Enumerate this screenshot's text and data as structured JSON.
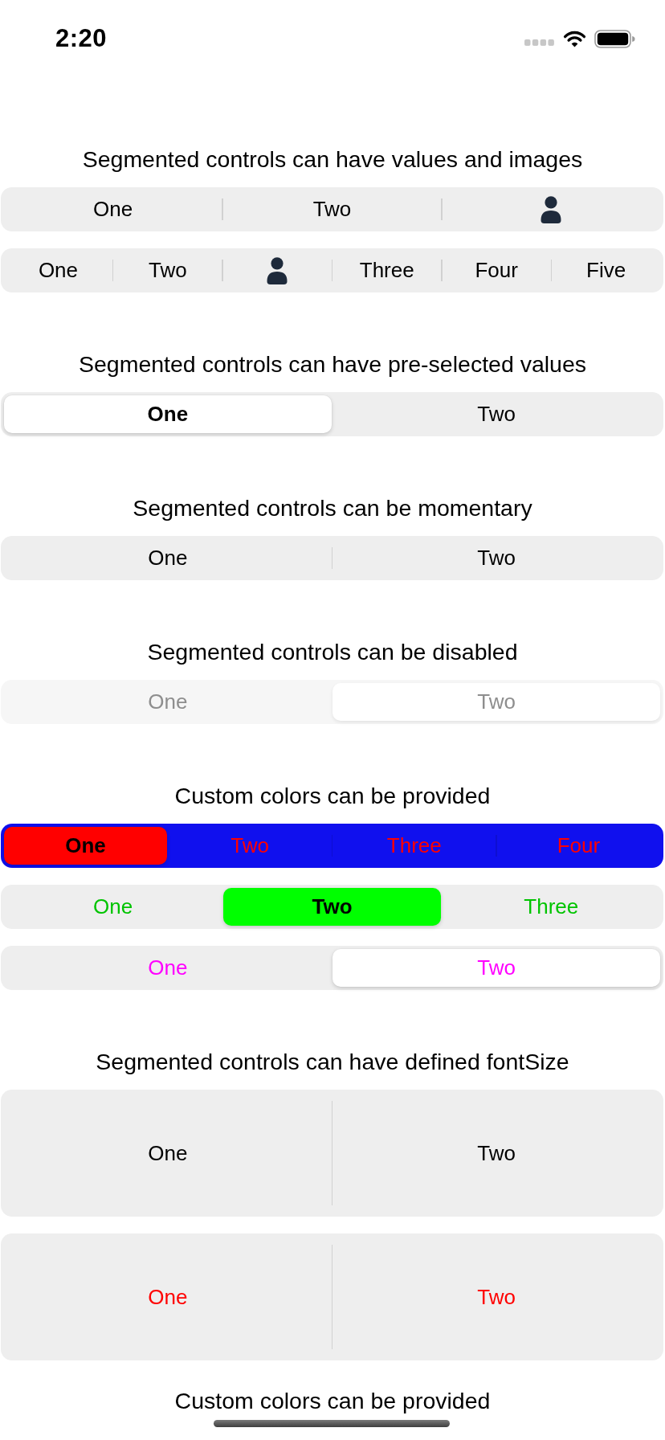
{
  "status_bar": {
    "time": "2:20"
  },
  "sections": [
    {
      "title": "Segmented controls can have values and images",
      "controls": [
        {
          "kind": "plain",
          "disabled": false,
          "segments": [
            {
              "kind": "text",
              "label": "One",
              "selected": false
            },
            {
              "kind": "text",
              "label": "Two",
              "selected": false
            },
            {
              "kind": "icon",
              "selected": false
            }
          ]
        },
        {
          "kind": "plain",
          "disabled": false,
          "segments": [
            {
              "kind": "text",
              "label": "One",
              "selected": false
            },
            {
              "kind": "text",
              "label": "Two",
              "selected": false
            },
            {
              "kind": "icon",
              "selected": false
            },
            {
              "kind": "text",
              "label": "Three",
              "selected": false
            },
            {
              "kind": "text",
              "label": "Four",
              "selected": false
            },
            {
              "kind": "text",
              "label": "Five",
              "selected": false
            }
          ]
        }
      ]
    },
    {
      "title": "Segmented controls can have pre-selected values",
      "controls": [
        {
          "kind": "plain",
          "disabled": false,
          "segments": [
            {
              "kind": "text",
              "label": "One",
              "selected": true
            },
            {
              "kind": "text",
              "label": "Two",
              "selected": false
            }
          ]
        }
      ]
    },
    {
      "title": "Segmented controls can be momentary",
      "controls": [
        {
          "kind": "plain",
          "disabled": false,
          "segments": [
            {
              "kind": "text",
              "label": "One",
              "selected": false
            },
            {
              "kind": "text",
              "label": "Two",
              "selected": false
            }
          ]
        }
      ]
    },
    {
      "title": "Segmented controls can be disabled",
      "controls": [
        {
          "kind": "plain",
          "disabled": true,
          "segments": [
            {
              "kind": "text",
              "label": "One",
              "selected": false
            },
            {
              "kind": "text",
              "label": "Two",
              "selected": true
            }
          ]
        }
      ]
    },
    {
      "title": "Custom colors can be provided",
      "controls": [
        {
          "kind": "blue",
          "disabled": false,
          "segments": [
            {
              "kind": "text",
              "label": "One",
              "selected": true
            },
            {
              "kind": "text",
              "label": "Two",
              "selected": false
            },
            {
              "kind": "text",
              "label": "Three",
              "selected": false
            },
            {
              "kind": "text",
              "label": "Four",
              "selected": false
            }
          ]
        },
        {
          "kind": "green",
          "disabled": false,
          "segments": [
            {
              "kind": "text",
              "label": "One",
              "selected": false
            },
            {
              "kind": "text",
              "label": "Two",
              "selected": true
            },
            {
              "kind": "text",
              "label": "Three",
              "selected": false
            }
          ]
        },
        {
          "kind": "magenta",
          "disabled": false,
          "segments": [
            {
              "kind": "text",
              "label": "One",
              "selected": false
            },
            {
              "kind": "text",
              "label": "Two",
              "selected": true
            }
          ]
        }
      ]
    },
    {
      "title": "Segmented controls can have defined fontSize",
      "controls": [
        {
          "kind": "tall",
          "disabled": false,
          "segments": [
            {
              "kind": "text",
              "label": "One",
              "selected": false
            },
            {
              "kind": "text",
              "label": "Two",
              "selected": false
            }
          ]
        },
        {
          "kind": "tall-red",
          "disabled": false,
          "segments": [
            {
              "kind": "text",
              "label": "One",
              "selected": false
            },
            {
              "kind": "text",
              "label": "Two",
              "selected": false
            }
          ]
        }
      ]
    },
    {
      "title": "Custom colors can be provided"
    }
  ]
}
